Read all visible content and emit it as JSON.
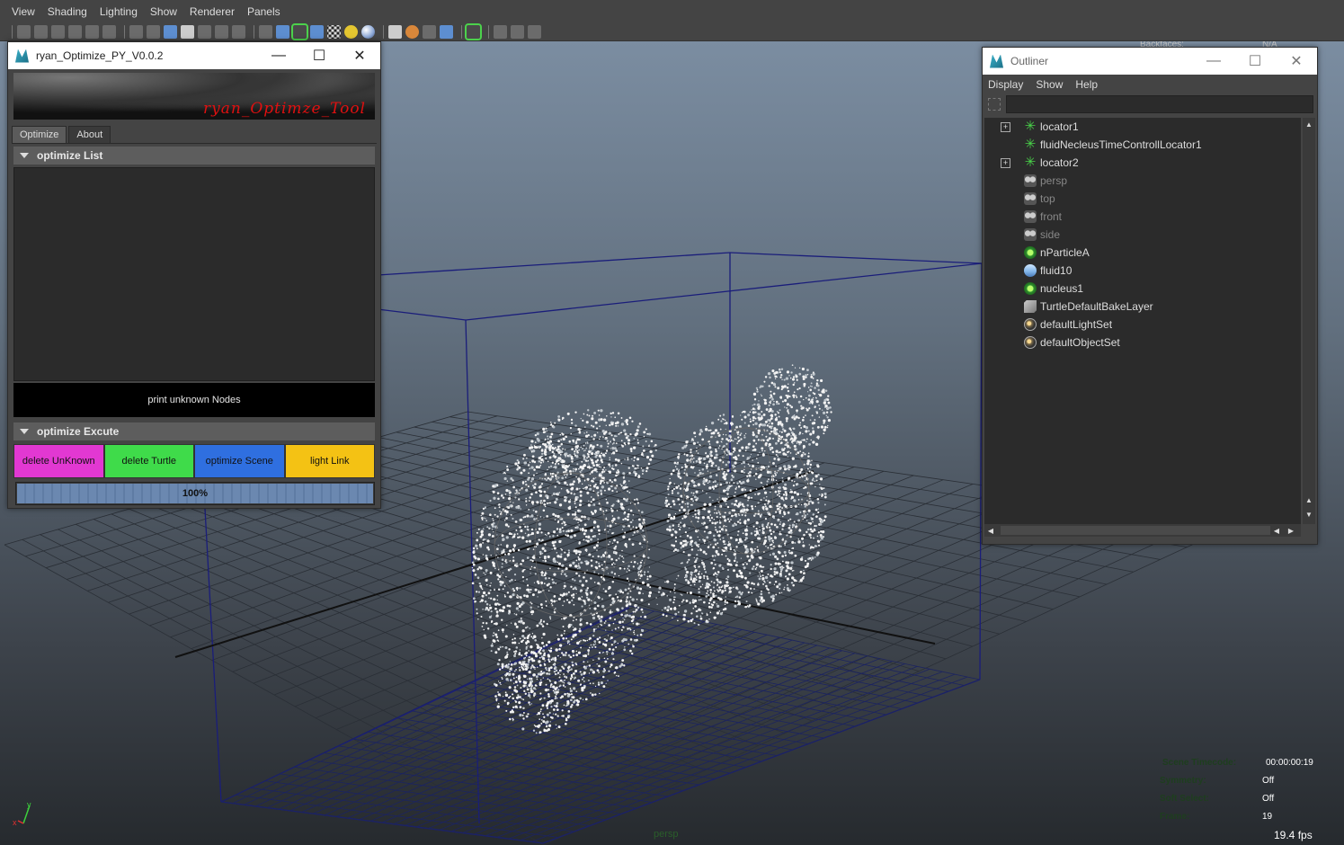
{
  "menu": [
    "View",
    "Shading",
    "Lighting",
    "Show",
    "Renderer",
    "Panels"
  ],
  "toolbar_icons": [
    "camera-select-icon",
    "camera-lock-icon",
    "camera-attr-icon",
    "bookmark-icon",
    "image-plane-icon",
    "2d-pan-icon",
    "grease-pencil-icon",
    "grid-icon",
    "film-gate-icon",
    "resolution-gate-icon",
    "gate-mask-icon",
    "field-chart-icon",
    "safe-action-icon",
    "safe-title-icon",
    "wireframe-icon",
    "smooth-shade-icon",
    "wireframe-on-shaded-icon",
    "default-material-icon",
    "textured-icon",
    "use-all-lights-icon",
    "shadows-icon",
    "ambient-occlusion-icon",
    "antialiasing-icon",
    "depth-of-field-icon",
    "motion-blur-icon",
    "xray-icon",
    "isolate-select-icon",
    "toggle-hud-icon",
    "isolate-icon",
    "ssao-icon"
  ],
  "optimize": {
    "title": "ryan_Optimize_PY_V0.0.2",
    "banner_text": "ryan_Optimze_Tool",
    "tabs": [
      "Optimize",
      "About"
    ],
    "list_header": "optimize List",
    "print_button": "print unknown Nodes",
    "excute_header": "optimize Excute",
    "actions": [
      {
        "label": "delete UnKnown",
        "color": "#e238d2"
      },
      {
        "label": "delete Turtle",
        "color": "#3fdb4a"
      },
      {
        "label": "optimize Scene",
        "color": "#2f6fe0"
      },
      {
        "label": "light Link",
        "color": "#f4c214"
      }
    ],
    "progress_label": "100%",
    "progress_value": 1.0
  },
  "outliner": {
    "title": "Outliner",
    "menu": [
      "Display",
      "Show",
      "Help"
    ],
    "search_value": "",
    "items": [
      {
        "label": "locator1",
        "icon": "locator-icon",
        "expandable": true,
        "dim": false
      },
      {
        "label": "fluidNecleusTimeControllLocator1",
        "icon": "locator-icon",
        "expandable": false,
        "dim": false
      },
      {
        "label": "locator2",
        "icon": "locator-icon",
        "expandable": true,
        "dim": false
      },
      {
        "label": "persp",
        "icon": "camera-icon",
        "expandable": false,
        "dim": true
      },
      {
        "label": "top",
        "icon": "camera-icon",
        "expandable": false,
        "dim": true
      },
      {
        "label": "front",
        "icon": "camera-icon",
        "expandable": false,
        "dim": true
      },
      {
        "label": "side",
        "icon": "camera-icon",
        "expandable": false,
        "dim": true
      },
      {
        "label": "nParticleA",
        "icon": "nparticle-icon",
        "expandable": false,
        "dim": false
      },
      {
        "label": "fluid10",
        "icon": "fluid-icon",
        "expandable": false,
        "dim": false
      },
      {
        "label": "nucleus1",
        "icon": "nucleus-icon",
        "expandable": false,
        "dim": false
      },
      {
        "label": "TurtleDefaultBakeLayer",
        "icon": "bake-layer-icon",
        "expandable": false,
        "dim": false
      },
      {
        "label": "defaultLightSet",
        "icon": "set-icon",
        "expandable": false,
        "dim": false
      },
      {
        "label": "defaultObjectSet",
        "icon": "set-icon",
        "expandable": false,
        "dim": false
      }
    ]
  },
  "hud": {
    "backfaces_label": "Backfaces:",
    "backfaces_value": "N/A",
    "rows": [
      {
        "label": "Scene Timecode:",
        "value": "00:00:00:19"
      },
      {
        "label": "Symmetry:",
        "value": "Off"
      },
      {
        "label": "Soft Select:",
        "value": "Off"
      },
      {
        "label": "Frame:",
        "value": "19"
      }
    ],
    "fps": "19.4 fps",
    "camera": "persp",
    "axis_y": "y",
    "axis_x": "x"
  }
}
